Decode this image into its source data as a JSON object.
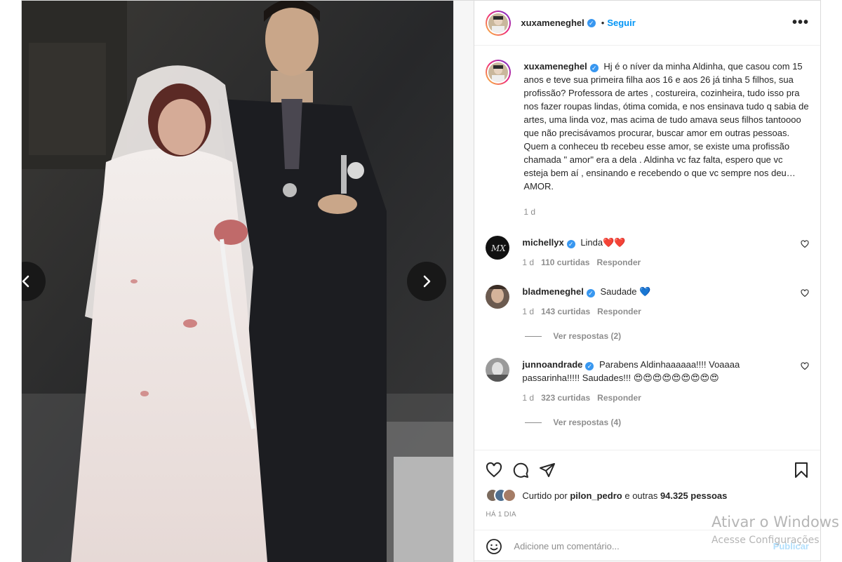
{
  "post": {
    "username": "xuxameneghel",
    "follow_label": "Seguir",
    "dot": "•",
    "more_label": "•••",
    "caption": "Hj é o níver da minha Aldinha, que casou com 15 anos e teve sua primeira filha aos 16 e aos 26 já tinha 5 filhos, sua profissão? Professora de artes , costureira, cozinheira, tudo isso pra nos fazer roupas lindas, ótima comida, e nos ensinava tudo q sabia de artes, uma linda voz, mas acima de tudo amava seus filhos tantoooo que não precisávamos procurar, buscar amor em outras pessoas. Quem a conheceu tb recebeu esse amor, se existe uma profissão chamada \" amor\" era a dela . Aldinha vc faz falta, espero que vc esteja bem aí , ensinando e recebendo o que vc sempre nos deu… AMOR.",
    "caption_age": "1 d"
  },
  "comments": [
    {
      "username": "michellyx",
      "text": "Linda❤️❤️",
      "age": "1 d",
      "likes": "110 curtidas",
      "reply_label": "Responder",
      "avatar_color": "#111111"
    },
    {
      "username": "bladmeneghel",
      "text": "Saudade 💙",
      "age": "1 d",
      "likes": "143 curtidas",
      "reply_label": "Responder",
      "avatar_color": "#6b5a4f",
      "view_replies": "Ver respostas (2)"
    },
    {
      "username": "junnoandrade",
      "text": "Parabens Aldinhaaaaaa!!!! Voaaaa passarinha!!!!! Saudades!!! 😍😍😍😍😍😍😍😍😍",
      "age": "1 d",
      "likes": "323 curtidas",
      "reply_label": "Responder",
      "avatar_color": "#9a9a9a",
      "view_replies": "Ver respostas (4)"
    }
  ],
  "footer": {
    "liked_prefix": "Curtido por ",
    "liked_user": "pilon_pedro",
    "liked_mid": " e outras ",
    "liked_count": "94.325 pessoas",
    "time_ago": "Há 1 dia",
    "comment_placeholder": "Adicione um comentário...",
    "publish_label": "Publicar"
  },
  "icons": {
    "prev": "chevron-left-icon",
    "next": "chevron-right-icon",
    "like": "heart-icon",
    "comment": "comment-icon",
    "share": "send-icon",
    "save": "bookmark-icon",
    "emoji": "emoji-icon"
  },
  "colors": {
    "link": "#0095f6",
    "verified": "#3897f0",
    "muted": "#8e8e8e"
  },
  "watermark": {
    "line1": "Ativar o Windows",
    "line2": "Acesse Configurações"
  }
}
